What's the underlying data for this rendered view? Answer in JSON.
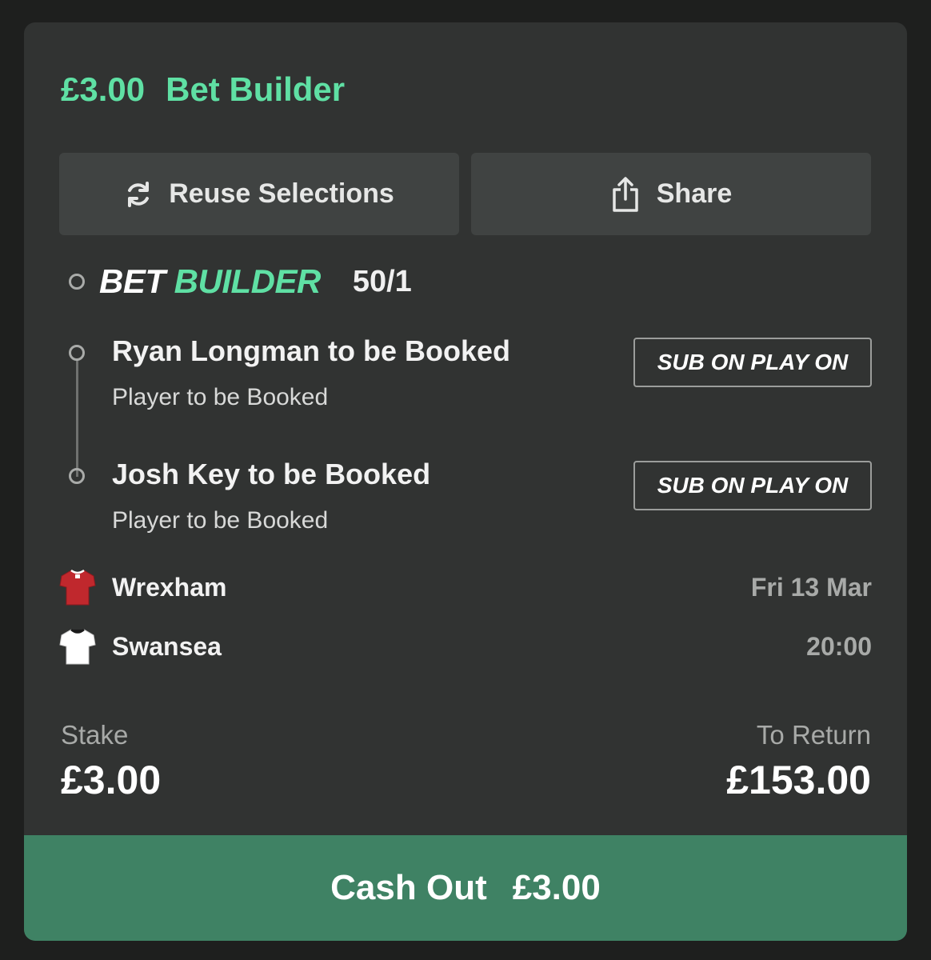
{
  "header": {
    "stake": "£3.00",
    "bet_type": "Bet Builder"
  },
  "actions": {
    "reuse_label": "Reuse Selections",
    "share_label": "Share"
  },
  "bet_builder": {
    "logo_part1": "BET",
    "logo_part2": "BUILDER",
    "odds": "50/1",
    "legs": [
      {
        "title": "Ryan Longman to be Booked",
        "market": "Player to be Booked",
        "badge": "SUB ON PLAY ON"
      },
      {
        "title": "Josh Key to be Booked",
        "market": "Player to be Booked",
        "badge": "SUB ON PLAY ON"
      }
    ]
  },
  "match": {
    "home": {
      "name": "Wrexham",
      "kit_color": "#c0282d"
    },
    "away": {
      "name": "Swansea",
      "kit_color": "#ffffff"
    },
    "date": "Fri 13 Mar",
    "time": "20:00"
  },
  "summary": {
    "stake_label": "Stake",
    "stake_value": "£3.00",
    "return_label": "To Return",
    "return_value": "£153.00"
  },
  "cashout": {
    "label": "Cash Out",
    "amount": "£3.00"
  },
  "colors": {
    "accent": "#5fe0a4",
    "cashout_bg": "#3f8264",
    "card_bg": "#313332"
  },
  "icons": {
    "reuse": "refresh-icon",
    "share": "share-icon"
  }
}
